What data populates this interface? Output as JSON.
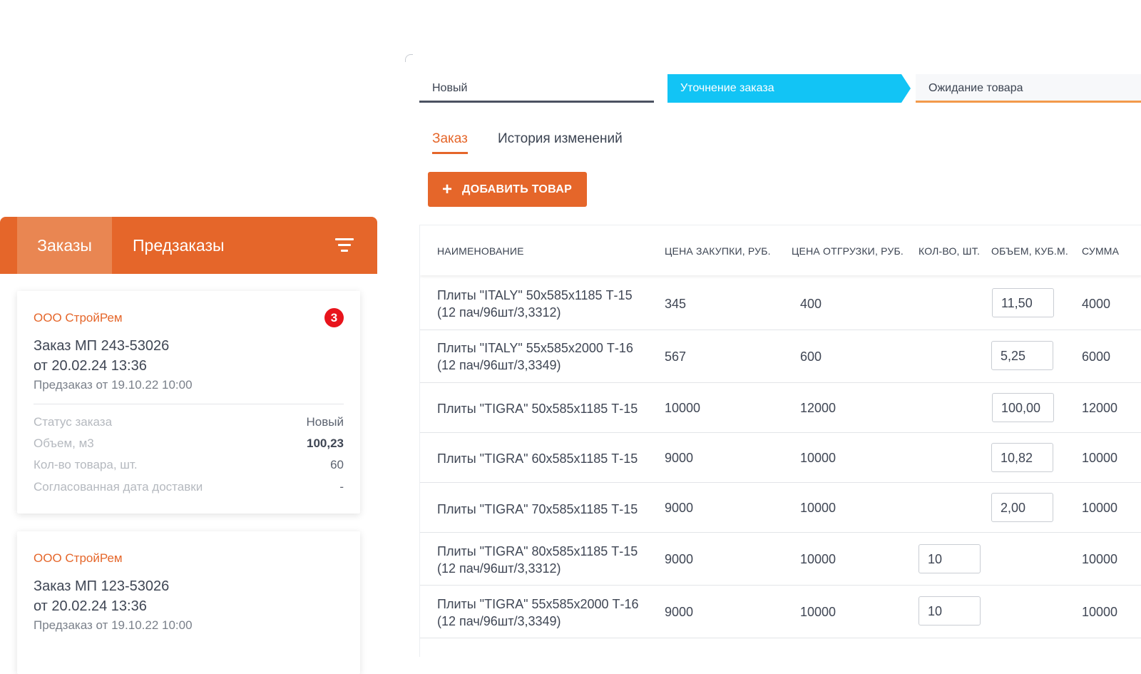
{
  "left_panel": {
    "tabs": [
      "Заказы",
      "Предзаказы"
    ],
    "cards": [
      {
        "company": "ООО СтройРем",
        "badge": "3",
        "title_line1": "Заказ МП 243-53026",
        "title_line2": "от 20.02.24 13:36",
        "preorder": "Предзаказ от 19.10.22 10:00",
        "status_label": "Статус заказа",
        "status_value": "Новый",
        "volume_label": "Объем, м3",
        "volume_value": "100,23",
        "qty_label": "Кол-во товара, шт.",
        "qty_value": "60",
        "date_label": "Согласованная дата доставки",
        "date_value": "-"
      },
      {
        "company": "ООО СтройРем",
        "title_line1": "Заказ МП 123-53026",
        "title_line2": "от 20.02.24 13:36",
        "preorder": "Предзаказ от 19.10.22 10:00"
      }
    ]
  },
  "steps": [
    "Новый",
    "Уточнение заказа",
    "Ожидание товара"
  ],
  "tabs": [
    "Заказ",
    "История изменений"
  ],
  "add_button": "ДОБАВИТЬ ТОВАР",
  "table": {
    "headers": [
      "НАИМЕНОВАНИЕ",
      "ЦЕНА ЗАКУПКИ, РУБ.",
      "ЦЕНА ОТГРУЗКИ, РУБ.",
      "КОЛ-ВО, ШТ.",
      "ОБЪЕМ, КУБ.М.",
      "СУММА"
    ],
    "rows": [
      {
        "name1": "Плиты \"ITALY\" 50x585x1185 Т-15",
        "name2": "(12 пач/96шт/3,3312)",
        "buy": "345",
        "sell": "400",
        "qty": "",
        "volume": "11,50",
        "sum": "4000"
      },
      {
        "name1": "Плиты \"ITALY\" 55x585x2000 Т-16",
        "name2": "(12 пач/96шт/3,3349)",
        "buy": "567",
        "sell": "600",
        "qty": "",
        "volume": "5,25",
        "sum": "6000"
      },
      {
        "name1": "Плиты \"TIGRA\" 50x585x1185 Т-15",
        "name2": "",
        "buy": "10000",
        "sell": "12000",
        "qty": "",
        "volume": "100,00",
        "sum": "12000"
      },
      {
        "name1": "Плиты \"TIGRA\" 60x585x1185 Т-15",
        "name2": "",
        "buy": "9000",
        "sell": "10000",
        "qty": "",
        "volume": "10,82",
        "sum": "10000"
      },
      {
        "name1": "Плиты \"TIGRA\" 70x585x1185 Т-15",
        "name2": "",
        "buy": "9000",
        "sell": "10000",
        "qty": "",
        "volume": "2,00",
        "sum": "10000"
      },
      {
        "name1": "Плиты \"TIGRA\" 80x585x1185 Т-15",
        "name2": "(12 пач/96шт/3,3312)",
        "buy": "9000",
        "sell": "10000",
        "qty": "10",
        "volume": "",
        "sum": "10000"
      },
      {
        "name1": "Плиты \"TIGRA\" 55x585x2000 Т-16",
        "name2": "(12 пач/96шт/3,3349)",
        "buy": "9000",
        "sell": "10000",
        "qty": "10",
        "volume": "",
        "sum": "10000"
      }
    ]
  },
  "colors": {
    "accent": "#e5662a",
    "active_step": "#12c4f5",
    "badge": "#e8141c"
  },
  "icons": [
    "filter-icon",
    "plus-icon"
  ]
}
